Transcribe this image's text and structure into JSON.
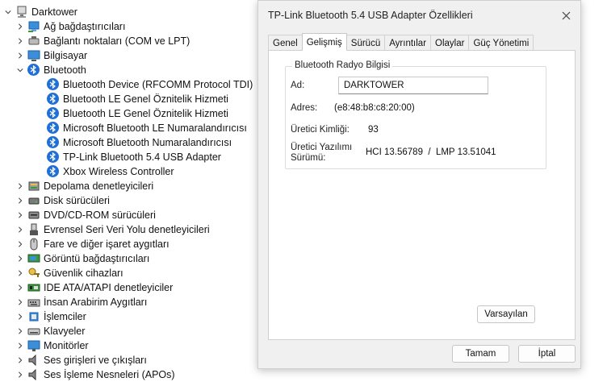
{
  "tree": {
    "root": "Darktower",
    "items": [
      {
        "label": "Ağ bağdaştırıcıları",
        "icon": "network-adapter-icon"
      },
      {
        "label": "Bağlantı noktaları (COM ve LPT)",
        "icon": "port-icon"
      },
      {
        "label": "Bilgisayar",
        "icon": "computer-icon"
      },
      {
        "label": "Bluetooth",
        "icon": "bluetooth-icon"
      },
      {
        "label": "Depolama denetleyicileri",
        "icon": "storage-controller-icon"
      },
      {
        "label": "Disk sürücüleri",
        "icon": "disk-drive-icon"
      },
      {
        "label": "DVD/CD-ROM sürücüleri",
        "icon": "dvd-drive-icon"
      },
      {
        "label": "Evrensel Seri Veri Yolu denetleyicileri",
        "icon": "usb-controller-icon"
      },
      {
        "label": "Fare ve diğer işaret aygıtları",
        "icon": "mouse-icon"
      },
      {
        "label": "Görüntü bağdaştırıcıları",
        "icon": "display-adapter-icon"
      },
      {
        "label": "Güvenlik cihazları",
        "icon": "security-device-icon"
      },
      {
        "label": "IDE ATA/ATAPI denetleyiciler",
        "icon": "ide-controller-icon"
      },
      {
        "label": "İnsan Arabirim Aygıtları",
        "icon": "hid-icon"
      },
      {
        "label": "İşlemciler",
        "icon": "processor-icon"
      },
      {
        "label": "Klavyeler",
        "icon": "keyboard-icon"
      },
      {
        "label": "Monitörler",
        "icon": "monitor-icon"
      },
      {
        "label": "Ses girişleri ve çıkışları",
        "icon": "audio-io-icon"
      },
      {
        "label": "Ses İşleme Nesneleri (APOs)",
        "icon": "audio-processing-icon"
      }
    ],
    "bluetooth_children": [
      "Bluetooth Device (RFCOMM Protocol TDI)",
      "Bluetooth LE Genel Öznitelik Hizmeti",
      "Bluetooth LE Genel Öznitelik Hizmeti",
      "Microsoft Bluetooth LE Numaralandırıcısı",
      "Microsoft Bluetooth Numaralandırıcısı",
      "TP-Link Bluetooth 5.4 USB Adapter",
      "Xbox Wireless Controller"
    ]
  },
  "dialog": {
    "title": "TP-Link Bluetooth 5.4 USB Adapter Özellikleri",
    "tabs": [
      "Genel",
      "Gelişmiş",
      "Sürücü",
      "Ayrıntılar",
      "Olaylar",
      "Güç Yönetimi"
    ],
    "active_tab": "Gelişmiş",
    "group_title": "Bluetooth Radyo Bilgisi",
    "name_label": "Ad:",
    "name_value": "DARKTOWER",
    "address_label": "Adres:",
    "address_value": "(e8:48:b8:c8:20:00)",
    "manufacturer_label": "Üretici Kimliği:",
    "manufacturer_value": "93",
    "firmware_label_1": "Üretici Yazılımı",
    "firmware_label_2": "Sürümü:",
    "firmware_value": "HCI 13.56789  /  LMP 13.51041",
    "default_button": "Varsayılan",
    "ok_button": "Tamam",
    "cancel_button": "İptal"
  },
  "colors": {
    "accent": "#1f6fd6",
    "dialog_bg": "#f0f0f0"
  }
}
